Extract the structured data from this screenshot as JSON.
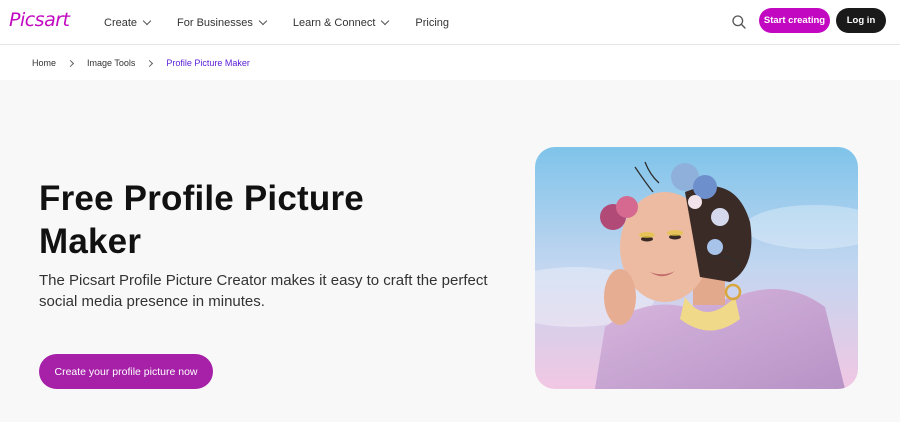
{
  "brand": {
    "logo_text": "Picsart",
    "accent": "#c209c1",
    "cta_color": "#a621a8"
  },
  "nav": {
    "items": [
      {
        "label": "Create",
        "has_dropdown": true
      },
      {
        "label": "For Businesses",
        "has_dropdown": true
      },
      {
        "label": "Learn & Connect",
        "has_dropdown": true
      },
      {
        "label": "Pricing",
        "has_dropdown": false
      }
    ],
    "search_icon": "search-icon",
    "start_label": "Start creating",
    "login_label": "Log in"
  },
  "breadcrumb": {
    "items": [
      "Home",
      "Image Tools",
      "Profile Picture Maker"
    ]
  },
  "hero": {
    "title": "Free Profile Picture Maker",
    "description": "The Picsart Profile Picture Creator makes it easy to craft the perfect social media presence in minutes.",
    "cta_label": "Create your profile picture now"
  }
}
